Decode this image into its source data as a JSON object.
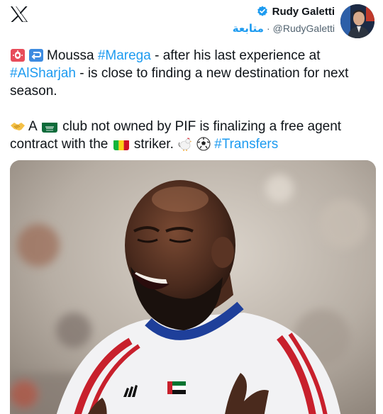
{
  "header": {
    "logo_icon": "x-logo-icon",
    "display_name": "Rudy Galetti",
    "verified_icon": "verified-badge-icon",
    "handle": "@RudyGaletti",
    "separator": "·",
    "follow_label": "متابعة"
  },
  "tweet": {
    "p1_a": "Moussa ",
    "p1_tag1": "#Marega",
    "p1_b": " - after his last experience at ",
    "p1_tag2": "#AlSharjah",
    "p1_c": " - is close to finding a new destination for next season.",
    "p2_a": "A ",
    "p2_b": " club not owned by PIF is finalizing a free agent contract with the ",
    "p2_c": " striker. ",
    "p2_tag": "#Transfers"
  },
  "colors": {
    "link": "#1d9bf0",
    "text": "#0f1419",
    "muted": "#536471"
  },
  "media": {
    "image_subject": "football-player-photo"
  }
}
